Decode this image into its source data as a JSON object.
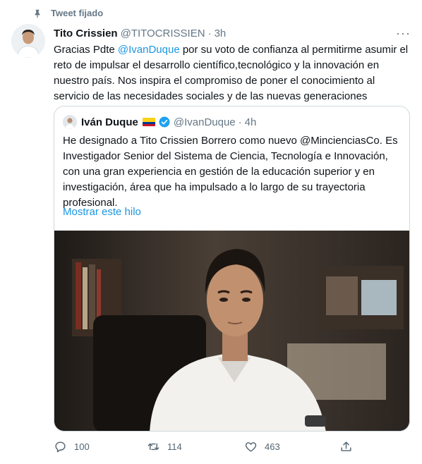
{
  "pinned": {
    "label": "Tweet fijado",
    "icon": "pin-icon"
  },
  "tweet": {
    "author_name": "Tito Crissien",
    "author_handle": "@TITOCRISSIEN",
    "separator": "·",
    "time": "3h",
    "more": "···",
    "text_line1_before": "Gracias  Pdte ",
    "text_mention": "@IvanDuque",
    "text_line1_after": " por su voto de confianza al permitirme asumir el reto de impulsar el desarrollo científico,tecnológico y la innovación en nuestro país. Nos inspira el compromiso de poner el conocimiento al servicio de las necesidades sociales y de las nuevas generaciones"
  },
  "quote": {
    "author_name": "Iván Duque",
    "author_handle": "@IvanDuque",
    "separator": "·",
    "time": "4h",
    "text": "He designado a Tito Crissien Borrero como nuevo @MincienciasCo. Es Investigador Senior del Sistema de Ciencia, Tecnología e Innovación, con una gran experiencia en gestión de la educación superior y en investigación, área que ha impulsado a lo largo de su trayectoria profesional.",
    "show_thread": "Mostrar este hilo"
  },
  "actions": {
    "replies": "100",
    "retweets": "114",
    "likes": "463"
  },
  "colors": {
    "link": "#1b95e0",
    "muted": "#657786",
    "border": "#cfd9de"
  }
}
